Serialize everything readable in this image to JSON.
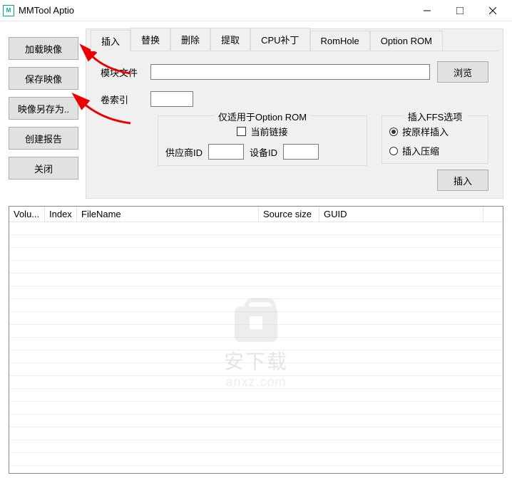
{
  "window": {
    "title": "MMTool Aptio"
  },
  "sidebar": {
    "load_image": "加载映像",
    "save_image": "保存映像",
    "save_image_as": "映像另存为..",
    "create_report": "创建报告",
    "close": "关闭"
  },
  "tabs": {
    "insert": "插入",
    "replace": "替换",
    "delete": "删除",
    "extract": "提取",
    "cpu_patch": "CPU补丁",
    "romhole": "RomHole",
    "option_rom": "Option ROM"
  },
  "form": {
    "module_file_label": "模块文件",
    "browse": "浏览",
    "volume_index_label": "卷索引",
    "option_rom_group": "仅适用于Option ROM",
    "current_link": "当前链接",
    "vendor_id": "供应商ID",
    "device_id": "设备ID",
    "ffs_group": "插入FFS选项",
    "insert_asis": "按原样插入",
    "insert_compressed": "插入压缩",
    "insert_btn": "插入"
  },
  "table": {
    "col_volume": "Volu...",
    "col_index": "Index",
    "col_filename": "FileName",
    "col_source_size": "Source size",
    "col_guid": "GUID"
  },
  "watermark": {
    "line1": "安下载",
    "line2": "anxz.com"
  }
}
